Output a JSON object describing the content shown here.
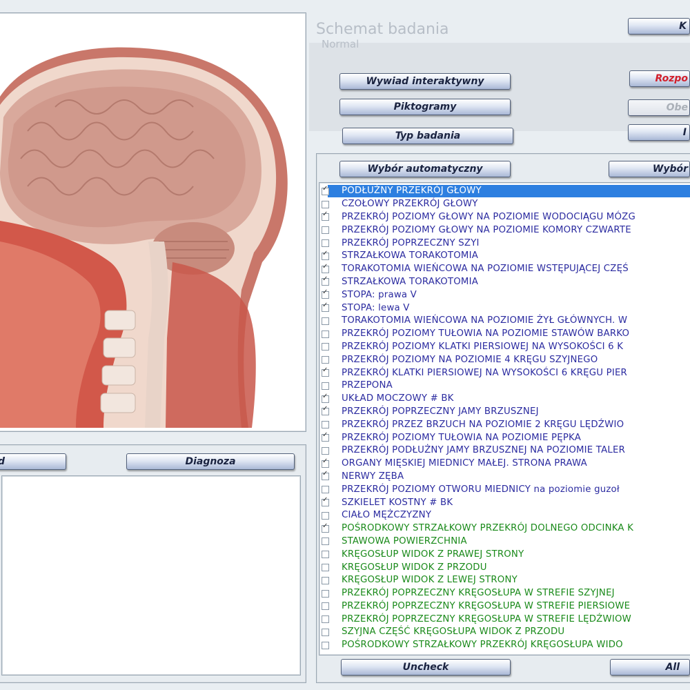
{
  "colors": {
    "blue_text": "#2b2ba0",
    "green_text": "#1a8a1a",
    "selection": "#2d7fe0",
    "red_label": "#d21f2b"
  },
  "image_panel": {
    "icon": "brain-anatomy-illustration"
  },
  "schemat": {
    "title": "Schemat badania",
    "subtitle": "Normal"
  },
  "top_right_buttons": {
    "k_label": "K",
    "rozpo_label": "Rozpo",
    "obe_label": "Obe",
    "r_label": "I"
  },
  "left_buttons": {
    "wywiad": "Wywiad interaktywny",
    "piktogramy": "Piktogramy",
    "typ": "Typ badania"
  },
  "selection_buttons": {
    "auto": "Wybór automatyczny",
    "manual": "Wybór"
  },
  "bottom_left_buttons": {
    "left": "d",
    "diagnoza": "Diagnoza"
  },
  "bottom_buttons": {
    "uncheck": "Uncheck",
    "all": "All"
  },
  "list_items": [
    {
      "label": "PODŁUŻNY PRZEKRÓJ GŁOWY",
      "checked": true,
      "color": "blue",
      "selected": true
    },
    {
      "label": "CZOŁOWY PRZEKRÓJ GŁOWY",
      "checked": false,
      "color": "blue"
    },
    {
      "label": "PRZEKRÓJ POZIOMY GŁOWY NA POZIOMIE WODOCIĄGU MÓZG",
      "checked": true,
      "color": "blue"
    },
    {
      "label": "PRZEKRÓJ POZIOMY GŁOWY NA POZIOMIE KOMORY CZWARTE",
      "checked": false,
      "color": "blue"
    },
    {
      "label": "PRZEKRÓJ POPRZECZNY SZYI",
      "checked": false,
      "color": "blue"
    },
    {
      "label": "STRZAŁKOWA TORAKOTOMIA",
      "checked": true,
      "color": "blue"
    },
    {
      "label": "TORAKOTOMIA WIEŃCOWA NA POZIOMIE WSTĘPUJĄCEJ CZĘŚ",
      "checked": true,
      "color": "blue"
    },
    {
      "label": "STRZAŁKOWA TORAKOTOMIA",
      "checked": true,
      "color": "blue"
    },
    {
      "label": "STOPA: prawa V",
      "checked": true,
      "color": "blue"
    },
    {
      "label": "STOPA: lewa V",
      "checked": true,
      "color": "blue"
    },
    {
      "label": "TORAKOTOMIA WIEŃCOWA NA POZIOMIE ŻYŁ GŁÓWNYCH. W",
      "checked": false,
      "color": "blue"
    },
    {
      "label": "PRZEKRÓJ POZIOMY TUŁOWIA NA POZIOMIE STAWÓW BARKO",
      "checked": false,
      "color": "blue"
    },
    {
      "label": "PRZEKRÓJ POZIOMY KLATKI PIERSIOWEJ NA WYSOKOŚCI 6 K",
      "checked": false,
      "color": "blue"
    },
    {
      "label": "PRZEKRÓJ POZIOMY NA POZIOMIE 4 KRĘGU SZYJNEGO",
      "checked": false,
      "color": "blue"
    },
    {
      "label": "PRZEKRÓJ KLATKI PIERSIOWEJ NA WYSOKOŚCI 6 KRĘGU PIER",
      "checked": true,
      "color": "blue"
    },
    {
      "label": "PRZEPONA",
      "checked": false,
      "color": "blue"
    },
    {
      "label": "UKŁAD MOCZOWY # BK",
      "checked": true,
      "color": "blue"
    },
    {
      "label": "PRZEKRÓJ POPRZECZNY JAMY BRZUSZNEJ",
      "checked": true,
      "color": "blue"
    },
    {
      "label": "PRZEKRÓJ PRZEZ BRZUCH NA POZIOMIE 2 KRĘGU LĘDŹWIO",
      "checked": false,
      "color": "blue"
    },
    {
      "label": "PRZEKRÓJ POZIOMY TUŁOWIA NA POZIOMIE PĘPKA",
      "checked": true,
      "color": "blue"
    },
    {
      "label": "PRZEKRÓJ PODŁUŻNY JAMY BRZUSZNEJ NA POZIOMIE TALER",
      "checked": false,
      "color": "blue"
    },
    {
      "label": "ORGANY MIĘSKIEJ MIEDNICY MAŁEJ. STRONA PRAWA",
      "checked": true,
      "color": "blue"
    },
    {
      "label": "NERWY ZĘBA",
      "checked": true,
      "color": "blue"
    },
    {
      "label": "PRZEKRÓJ POZIOMY OTWORU MIEDNICY na poziomie guzoł",
      "checked": false,
      "color": "blue"
    },
    {
      "label": "SZKIELET KOSTNY # BK",
      "checked": true,
      "color": "blue"
    },
    {
      "label": "CIAŁO MĘŻCZYZNY",
      "checked": false,
      "color": "blue"
    },
    {
      "label": "POŚRODKOWY STRZAŁKOWY PRZEKRÓJ DOLNEGO ODCINKA K",
      "checked": true,
      "color": "green"
    },
    {
      "label": "STAWOWA POWIERZCHNIA",
      "checked": false,
      "color": "green"
    },
    {
      "label": "KRĘGOSŁUP WIDOK Z PRAWEJ STRONY",
      "checked": false,
      "color": "green"
    },
    {
      "label": "KRĘGOSŁUP WIDOK Z PRZODU",
      "checked": false,
      "color": "green"
    },
    {
      "label": "KRĘGOSŁUP WIDOK Z LEWEJ STRONY",
      "checked": false,
      "color": "green"
    },
    {
      "label": "PRZEKRÓJ POPRZECZNY KRĘGOSŁUPA W STREFIE SZYJNEJ",
      "checked": false,
      "color": "green"
    },
    {
      "label": "PRZEKRÓJ POPRZECZNY KRĘGOSŁUPA W STREFIE PIERSIOWE",
      "checked": false,
      "color": "green"
    },
    {
      "label": "PRZEKRÓJ POPRZECZNY KRĘGOSŁUPA W STREFIE LĘDŹWIOW",
      "checked": false,
      "color": "green"
    },
    {
      "label": "SZYJNA CZĘŚĆ KRĘGOSŁUPA WIDOK Z PRZODU",
      "checked": false,
      "color": "green"
    },
    {
      "label": "POŚRODKOWY STRZAŁKOWY PRZEKRÓJ KRĘGOSŁUPA WIDO",
      "checked": false,
      "color": "green"
    }
  ]
}
